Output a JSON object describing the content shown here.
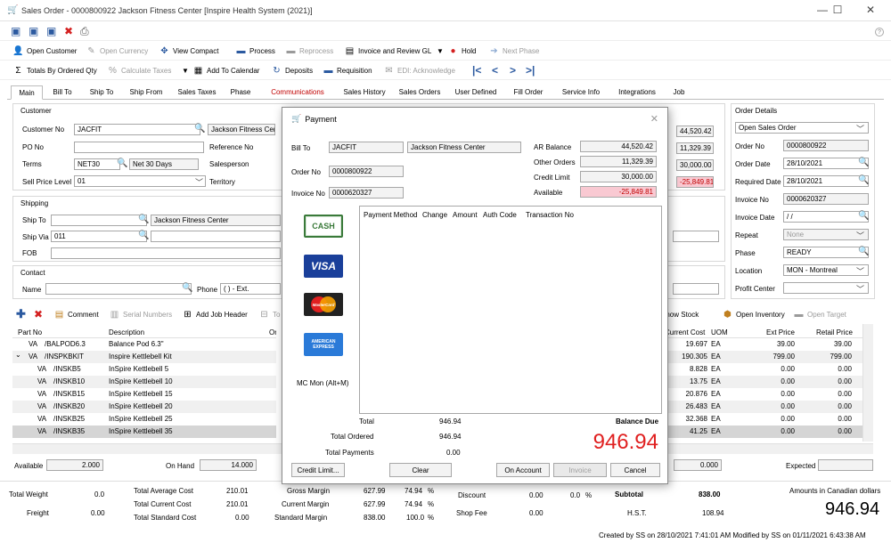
{
  "window": {
    "title": "Sales Order - 0000800922 Jackson Fitness Center [Inspire Health System (2021)]",
    "minimize": "—",
    "maximize": "☐",
    "close": "✕",
    "help": "?"
  },
  "toolbar1": {
    "open_customer": "Open Customer",
    "open_currency": "Open Currency",
    "view_compact": "View Compact",
    "process": "Process",
    "reprocess": "Reprocess",
    "invoice_review_gl": "Invoice and Review GL",
    "hold": "Hold",
    "next_phase": "Next Phase"
  },
  "toolbar2": {
    "totals_by_ordered_qty": "Totals By Ordered Qty",
    "calculate_taxes": "Calculate Taxes",
    "add_to_calendar": "Add To Calendar",
    "deposits": "Deposits",
    "requisition": "Requisition",
    "edi_acknowledge": "EDI: Acknowledge"
  },
  "tabs": [
    "Main",
    "Bill To",
    "Ship To",
    "Ship From",
    "Sales Taxes",
    "Phase",
    "Communications",
    "Sales History",
    "Sales Orders",
    "User Defined",
    "Fill Order",
    "Service Info",
    "Integrations",
    "Job"
  ],
  "customer": {
    "section_title": "Customer",
    "customer_no_label": "Customer No",
    "customer_no": "JACFIT",
    "customer_name": "Jackson Fitness Center",
    "po_no_label": "PO No",
    "po_no": "",
    "reference_no_label": "Reference No",
    "terms_label": "Terms",
    "terms_code": "NET30",
    "terms_desc": "Net 30 Days",
    "salesperson_label": "Salesperson",
    "sell_price_level_label": "Sell Price Level",
    "sell_price_level": "01",
    "territory_label": "Territory"
  },
  "balances": {
    "ar_balance": "44,520.42",
    "other_orders": "11,329.39",
    "credit_limit": "30,000.00",
    "available": "-25,849.81"
  },
  "shipping": {
    "section_title": "Shipping",
    "ship_to_label": "Ship To",
    "ship_to_name": "Jackson Fitness Center",
    "ship_via_label": "Ship Via",
    "ship_via": "011",
    "fob_label": "FOB"
  },
  "contact": {
    "section_title": "Contact",
    "name_label": "Name",
    "phone_label": "Phone",
    "phone_value": "(   )   -     Ext."
  },
  "order_details": {
    "section_title": "Order Details",
    "status": "Open Sales Order",
    "order_no_label": "Order No",
    "order_no": "0000800922",
    "order_date_label": "Order Date",
    "order_date": "28/10/2021",
    "required_date_label": "Required Date",
    "required_date": "28/10/2021",
    "invoice_no_label": "Invoice No",
    "invoice_no": "0000620327",
    "invoice_date_label": "Invoice Date",
    "invoice_date": "  /  /",
    "repeat_label": "Repeat",
    "repeat": "None",
    "phase_label": "Phase",
    "phase": "READY",
    "location_label": "Location",
    "location": "MON - Montreal",
    "profit_center_label": "Profit Center"
  },
  "lines_toolbar": {
    "comment": "Comment",
    "serial_numbers": "Serial Numbers",
    "add_job_header": "Add Job Header",
    "to": "To",
    "show_stock": "Show Stock",
    "open_inventory": "Open Inventory",
    "open_target": "Open Target"
  },
  "grid": {
    "col_part_no": "Part No",
    "col_description": "Description",
    "col_ord": "Ord",
    "col_current_cost": "Current Cost",
    "col_uom": "UOM",
    "col_ext_price": "Ext Price",
    "col_retail_price": "Retail Price",
    "rows": [
      {
        "type": "VA",
        "part": "/BALPOD6.3",
        "desc": "Balance Pod 6.3\"",
        "cost": "19.697",
        "uom": "EA",
        "ext": "39.00",
        "retail": "39.00"
      },
      {
        "type": "VA",
        "part": "/INSPKBKIT",
        "desc": "Inspire Kettlebell Kit",
        "cost": "190.305",
        "uom": "EA",
        "ext": "799.00",
        "retail": "799.00"
      },
      {
        "type": "VA",
        "part": "/INSKB5",
        "desc": "InSpire Kettlebell 5",
        "cost": "8.828",
        "uom": "EA",
        "ext": "0.00",
        "retail": "0.00"
      },
      {
        "type": "VA",
        "part": "/INSKB10",
        "desc": "InSpire Kettlebell 10",
        "cost": "13.75",
        "uom": "EA",
        "ext": "0.00",
        "retail": "0.00"
      },
      {
        "type": "VA",
        "part": "/INSKB15",
        "desc": "InSpire Kettlebell 15",
        "cost": "20.876",
        "uom": "EA",
        "ext": "0.00",
        "retail": "0.00"
      },
      {
        "type": "VA",
        "part": "/INSKB20",
        "desc": "InSpire Kettlebell 20",
        "cost": "26.483",
        "uom": "EA",
        "ext": "0.00",
        "retail": "0.00"
      },
      {
        "type": "VA",
        "part": "/INSKB25",
        "desc": "InSpire Kettlebell 25",
        "cost": "32.368",
        "uom": "EA",
        "ext": "0.00",
        "retail": "0.00"
      },
      {
        "type": "VA",
        "part": "/INSKB35",
        "desc": "InSpire Kettlebell 35",
        "cost": "41.25",
        "uom": "EA",
        "ext": "0.00",
        "retail": "0.00"
      }
    ]
  },
  "stock": {
    "available_label": "Available",
    "available": "2.000",
    "on_hand_label": "On Hand",
    "on_hand": "14.000",
    "ext_value": "0.000",
    "expected_label": "Expected"
  },
  "totals": {
    "total_weight_label": "Total Weight",
    "total_weight": "0.0",
    "freight_label": "Freight",
    "freight": "0.00",
    "total_average_cost_label": "Total Average Cost",
    "total_average_cost": "210.01",
    "total_current_cost_label": "Total Current Cost",
    "total_current_cost": "210.01",
    "total_standard_cost_label": "Total Standard Cost",
    "total_standard_cost": "0.00",
    "gross_margin_label": "Gross Margin",
    "gross_margin": "627.99",
    "gross_margin_pct": "74.94",
    "current_margin_label": "Current Margin",
    "current_margin": "627.99",
    "current_margin_pct": "74.94",
    "standard_margin_label": "Standard Margin",
    "standard_margin": "838.00",
    "standard_margin_pct": "100.0",
    "pct": "%",
    "discount_label": "Discount",
    "discount": "0.00",
    "discount_pct": "0.0",
    "shop_fee_label": "Shop Fee",
    "shop_fee": "0.00",
    "subtotal_label": "Subtotal",
    "subtotal": "838.00",
    "hst_label": "H.S.T.",
    "hst": "108.94",
    "currency_note": "Amounts in Canadian dollars",
    "grand_total": "946.94",
    "audit": "Created by SS on 28/10/2021 7:41:01 AM  Modified by SS on 01/11/2021 6:43:38 AM"
  },
  "payment": {
    "title": "Payment",
    "bill_to_label": "Bill To",
    "bill_to_code": "JACFIT",
    "bill_to_name": "Jackson Fitness Center",
    "order_no_label": "Order No",
    "order_no": "0000800922",
    "invoice_no_label": "Invoice No",
    "invoice_no": "0000620327",
    "ar_balance_label": "AR Balance",
    "other_orders_label": "Other Orders",
    "credit_limit_label": "Credit Limit",
    "available_label": "Available",
    "col_payment_method": "Payment Method",
    "col_change": "Change",
    "col_amount": "Amount",
    "col_auth_code": "Auth Code",
    "col_transaction_no": "Transaction No",
    "cash": "CASH",
    "visa": "VISA",
    "mastercard": "MasterCard",
    "amex": "AMERICAN EXPRESS",
    "mc_mon": "MC Mon (Alt+M)",
    "total_label": "Total",
    "total": "946.94",
    "total_ordered_label": "Total Ordered",
    "total_ordered": "946.94",
    "total_payments_label": "Total Payments",
    "total_payments": "0.00",
    "balance_due_label": "Balance Due",
    "balance_due": "946.94",
    "btn_credit_limit": "Credit Limit...",
    "btn_clear": "Clear",
    "btn_on_account": "On Account",
    "btn_invoice": "Invoice",
    "btn_cancel": "Cancel"
  },
  "colors": {
    "accent_blue": "#2c5aa0",
    "negative_red": "#c00000",
    "balance_red": "#e02020",
    "negative_bg": "#f9c9d2"
  }
}
